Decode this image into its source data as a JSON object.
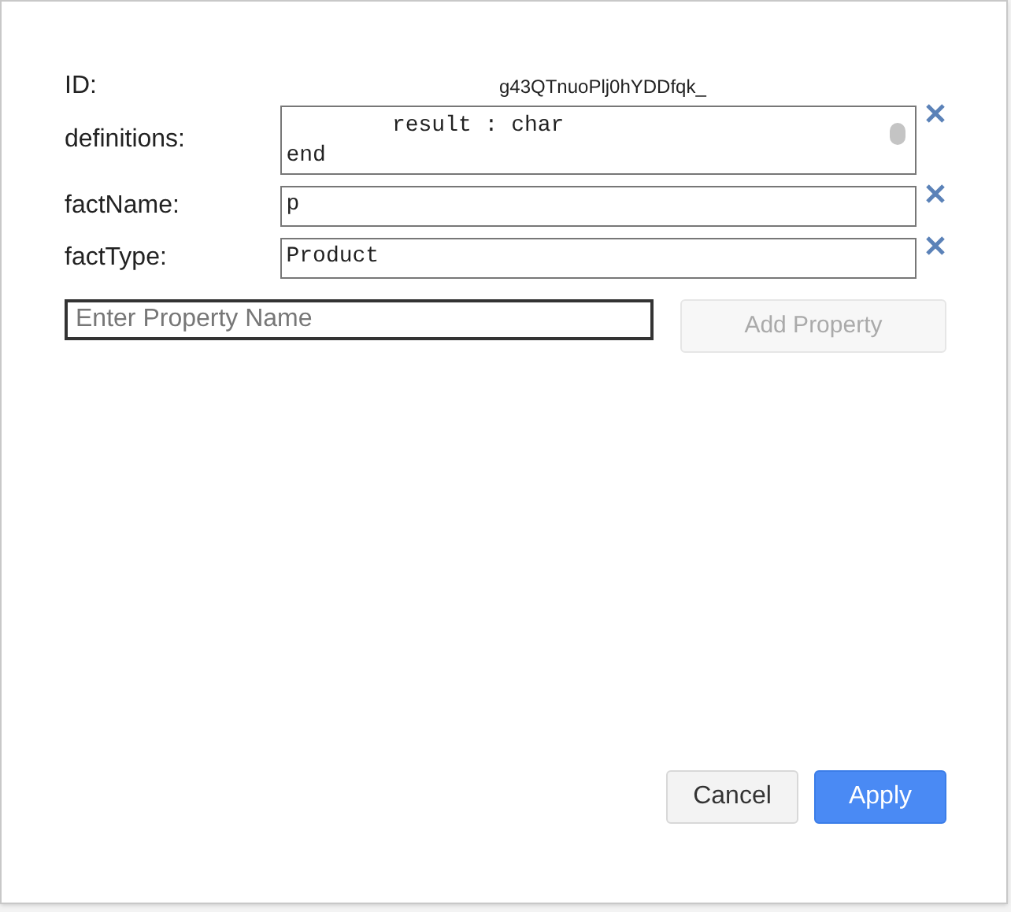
{
  "id_row": {
    "label": "ID:",
    "value": "g43QTnuoPlj0hYDDfqk_"
  },
  "fields": [
    {
      "label": "definitions:",
      "value": "        result : char\nend",
      "kind": "multiline"
    },
    {
      "label": "factName:",
      "value": "p",
      "kind": "single"
    },
    {
      "label": "factType:",
      "value": "Product",
      "kind": "single"
    }
  ],
  "property_input": {
    "placeholder": "Enter Property Name"
  },
  "add_button": {
    "label": "Add Property",
    "disabled": true
  },
  "buttons": [
    {
      "label": "Cancel",
      "kind": "secondary"
    },
    {
      "label": "Apply",
      "kind": "primary"
    }
  ]
}
